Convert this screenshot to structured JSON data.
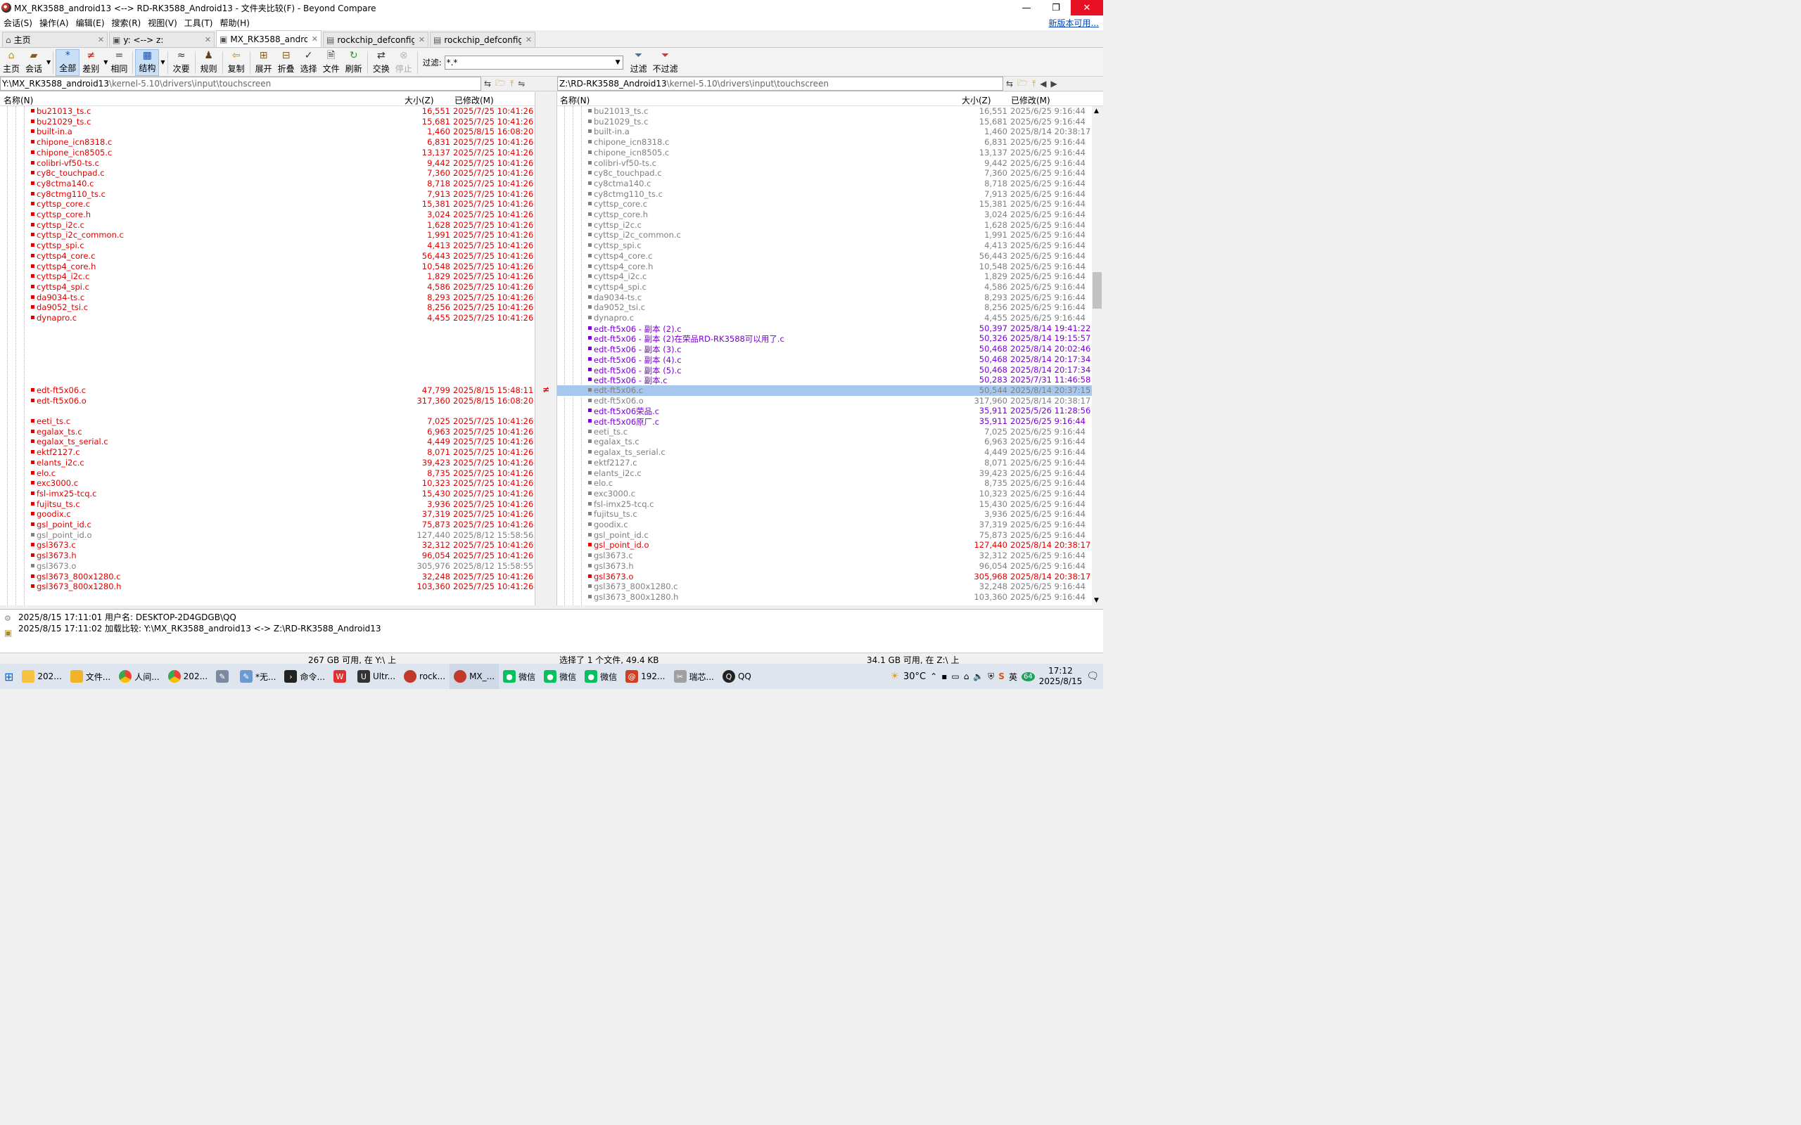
{
  "window": {
    "title": "MX_RK3588_android13 <--> RD-RK3588_Android13 - 文件夹比较(F) - Beyond Compare"
  },
  "menu": [
    "会话(S)",
    "操作(A)",
    "编辑(E)",
    "搜索(R)",
    "视图(V)",
    "工具(T)",
    "帮助(H)"
  ],
  "new_version": "新版本可用...",
  "tabs": [
    {
      "label": "主页"
    },
    {
      "label": "y: <--> z:"
    },
    {
      "label": "MX_RK3588_androi..."
    },
    {
      "label": "rockchip_defconfig"
    },
    {
      "label": "rockchip_defconfig ..."
    }
  ],
  "toolbar": {
    "home": "主页",
    "session": "会话",
    "all": "全部",
    "diff": "差别",
    "same": "相同",
    "structure": "结构",
    "minor": "次要",
    "rules": "规则",
    "copy": "复制",
    "expand": "展开",
    "collapse": "折叠",
    "select": "选择",
    "files": "文件",
    "refresh": "刷新",
    "swap": "交换",
    "stop": "停止",
    "filter_label": "过滤:",
    "filter_value": "*.*",
    "filter_btn": "过滤",
    "unfilter_btn": "不过滤"
  },
  "left": {
    "path_root": "Y:\\MX_RK3588_android13",
    "path_rest": "\\kernel-5.10\\drivers\\input\\touchscreen",
    "col_name": "名称(N)",
    "col_size": "大小(Z)",
    "col_modified": "已修改(M)",
    "rows": [
      {
        "name": "bu21013_ts.c",
        "size": "16,551",
        "date": "2025/7/25 10:41:26",
        "status": "red"
      },
      {
        "name": "bu21029_ts.c",
        "size": "15,681",
        "date": "2025/7/25 10:41:26",
        "status": "red"
      },
      {
        "name": "built-in.a",
        "size": "1,460",
        "date": "2025/8/15 16:08:20",
        "status": "red"
      },
      {
        "name": "chipone_icn8318.c",
        "size": "6,831",
        "date": "2025/7/25 10:41:26",
        "status": "red"
      },
      {
        "name": "chipone_icn8505.c",
        "size": "13,137",
        "date": "2025/7/25 10:41:26",
        "status": "red"
      },
      {
        "name": "colibri-vf50-ts.c",
        "size": "9,442",
        "date": "2025/7/25 10:41:26",
        "status": "red"
      },
      {
        "name": "cy8c_touchpad.c",
        "size": "7,360",
        "date": "2025/7/25 10:41:26",
        "status": "red"
      },
      {
        "name": "cy8ctma140.c",
        "size": "8,718",
        "date": "2025/7/25 10:41:26",
        "status": "red"
      },
      {
        "name": "cy8ctmg110_ts.c",
        "size": "7,913",
        "date": "2025/7/25 10:41:26",
        "status": "red"
      },
      {
        "name": "cyttsp_core.c",
        "size": "15,381",
        "date": "2025/7/25 10:41:26",
        "status": "red"
      },
      {
        "name": "cyttsp_core.h",
        "size": "3,024",
        "date": "2025/7/25 10:41:26",
        "status": "red"
      },
      {
        "name": "cyttsp_i2c.c",
        "size": "1,628",
        "date": "2025/7/25 10:41:26",
        "status": "red"
      },
      {
        "name": "cyttsp_i2c_common.c",
        "size": "1,991",
        "date": "2025/7/25 10:41:26",
        "status": "red"
      },
      {
        "name": "cyttsp_spi.c",
        "size": "4,413",
        "date": "2025/7/25 10:41:26",
        "status": "red"
      },
      {
        "name": "cyttsp4_core.c",
        "size": "56,443",
        "date": "2025/7/25 10:41:26",
        "status": "red"
      },
      {
        "name": "cyttsp4_core.h",
        "size": "10,548",
        "date": "2025/7/25 10:41:26",
        "status": "red"
      },
      {
        "name": "cyttsp4_i2c.c",
        "size": "1,829",
        "date": "2025/7/25 10:41:26",
        "status": "red"
      },
      {
        "name": "cyttsp4_spi.c",
        "size": "4,586",
        "date": "2025/7/25 10:41:26",
        "status": "red"
      },
      {
        "name": "da9034-ts.c",
        "size": "8,293",
        "date": "2025/7/25 10:41:26",
        "status": "red"
      },
      {
        "name": "da9052_tsi.c",
        "size": "8,256",
        "date": "2025/7/25 10:41:26",
        "status": "red"
      },
      {
        "name": "dynapro.c",
        "size": "4,455",
        "date": "2025/7/25 10:41:26",
        "status": "red"
      },
      {
        "name": "",
        "size": "",
        "date": "",
        "status": "empty"
      },
      {
        "name": "",
        "size": "",
        "date": "",
        "status": "empty"
      },
      {
        "name": "",
        "size": "",
        "date": "",
        "status": "empty"
      },
      {
        "name": "",
        "size": "",
        "date": "",
        "status": "empty"
      },
      {
        "name": "",
        "size": "",
        "date": "",
        "status": "empty"
      },
      {
        "name": "",
        "size": "",
        "date": "",
        "status": "empty"
      },
      {
        "name": "edt-ft5x06.c",
        "size": "47,799",
        "date": "2025/8/15 15:48:11",
        "status": "red"
      },
      {
        "name": "edt-ft5x06.o",
        "size": "317,360",
        "date": "2025/8/15 16:08:20",
        "status": "red"
      },
      {
        "name": "",
        "size": "",
        "date": "",
        "status": "empty"
      },
      {
        "name": "eeti_ts.c",
        "size": "7,025",
        "date": "2025/7/25 10:41:26",
        "status": "red"
      },
      {
        "name": "egalax_ts.c",
        "size": "6,963",
        "date": "2025/7/25 10:41:26",
        "status": "red"
      },
      {
        "name": "egalax_ts_serial.c",
        "size": "4,449",
        "date": "2025/7/25 10:41:26",
        "status": "red"
      },
      {
        "name": "ektf2127.c",
        "size": "8,071",
        "date": "2025/7/25 10:41:26",
        "status": "red"
      },
      {
        "name": "elants_i2c.c",
        "size": "39,423",
        "date": "2025/7/25 10:41:26",
        "status": "red"
      },
      {
        "name": "elo.c",
        "size": "8,735",
        "date": "2025/7/25 10:41:26",
        "status": "red"
      },
      {
        "name": "exc3000.c",
        "size": "10,323",
        "date": "2025/7/25 10:41:26",
        "status": "red"
      },
      {
        "name": "fsl-imx25-tcq.c",
        "size": "15,430",
        "date": "2025/7/25 10:41:26",
        "status": "red"
      },
      {
        "name": "fujitsu_ts.c",
        "size": "3,936",
        "date": "2025/7/25 10:41:26",
        "status": "red"
      },
      {
        "name": "goodix.c",
        "size": "37,319",
        "date": "2025/7/25 10:41:26",
        "status": "red"
      },
      {
        "name": "gsl_point_id.c",
        "size": "75,873",
        "date": "2025/7/25 10:41:26",
        "status": "red"
      },
      {
        "name": "gsl_point_id.o",
        "size": "127,440",
        "date": "2025/8/12 15:58:56",
        "status": "gray"
      },
      {
        "name": "gsl3673.c",
        "size": "32,312",
        "date": "2025/7/25 10:41:26",
        "status": "red"
      },
      {
        "name": "gsl3673.h",
        "size": "96,054",
        "date": "2025/7/25 10:41:26",
        "status": "red"
      },
      {
        "name": "gsl3673.o",
        "size": "305,976",
        "date": "2025/8/12 15:58:55",
        "status": "gray"
      },
      {
        "name": "gsl3673_800x1280.c",
        "size": "32,248",
        "date": "2025/7/25 10:41:26",
        "status": "red"
      },
      {
        "name": "gsl3673_800x1280.h",
        "size": "103,360",
        "date": "2025/7/25 10:41:26",
        "status": "red"
      }
    ]
  },
  "right": {
    "path_root": "Z:\\RD-RK3588_Android13",
    "path_rest": "\\kernel-5.10\\drivers\\input\\touchscreen",
    "col_name": "名称(N)",
    "col_size": "大小(Z)",
    "col_modified": "已修改(M)",
    "rows": [
      {
        "name": "bu21013_ts.c",
        "size": "16,551",
        "date": "2025/6/25 9:16:44",
        "status": "gray"
      },
      {
        "name": "bu21029_ts.c",
        "size": "15,681",
        "date": "2025/6/25 9:16:44",
        "status": "gray"
      },
      {
        "name": "built-in.a",
        "size": "1,460",
        "date": "2025/8/14 20:38:17",
        "status": "gray"
      },
      {
        "name": "chipone_icn8318.c",
        "size": "6,831",
        "date": "2025/6/25 9:16:44",
        "status": "gray"
      },
      {
        "name": "chipone_icn8505.c",
        "size": "13,137",
        "date": "2025/6/25 9:16:44",
        "status": "gray"
      },
      {
        "name": "colibri-vf50-ts.c",
        "size": "9,442",
        "date": "2025/6/25 9:16:44",
        "status": "gray"
      },
      {
        "name": "cy8c_touchpad.c",
        "size": "7,360",
        "date": "2025/6/25 9:16:44",
        "status": "gray"
      },
      {
        "name": "cy8ctma140.c",
        "size": "8,718",
        "date": "2025/6/25 9:16:44",
        "status": "gray"
      },
      {
        "name": "cy8ctmg110_ts.c",
        "size": "7,913",
        "date": "2025/6/25 9:16:44",
        "status": "gray"
      },
      {
        "name": "cyttsp_core.c",
        "size": "15,381",
        "date": "2025/6/25 9:16:44",
        "status": "gray"
      },
      {
        "name": "cyttsp_core.h",
        "size": "3,024",
        "date": "2025/6/25 9:16:44",
        "status": "gray"
      },
      {
        "name": "cyttsp_i2c.c",
        "size": "1,628",
        "date": "2025/6/25 9:16:44",
        "status": "gray"
      },
      {
        "name": "cyttsp_i2c_common.c",
        "size": "1,991",
        "date": "2025/6/25 9:16:44",
        "status": "gray"
      },
      {
        "name": "cyttsp_spi.c",
        "size": "4,413",
        "date": "2025/6/25 9:16:44",
        "status": "gray"
      },
      {
        "name": "cyttsp4_core.c",
        "size": "56,443",
        "date": "2025/6/25 9:16:44",
        "status": "gray"
      },
      {
        "name": "cyttsp4_core.h",
        "size": "10,548",
        "date": "2025/6/25 9:16:44",
        "status": "gray"
      },
      {
        "name": "cyttsp4_i2c.c",
        "size": "1,829",
        "date": "2025/6/25 9:16:44",
        "status": "gray"
      },
      {
        "name": "cyttsp4_spi.c",
        "size": "4,586",
        "date": "2025/6/25 9:16:44",
        "status": "gray"
      },
      {
        "name": "da9034-ts.c",
        "size": "8,293",
        "date": "2025/6/25 9:16:44",
        "status": "gray"
      },
      {
        "name": "da9052_tsi.c",
        "size": "8,256",
        "date": "2025/6/25 9:16:44",
        "status": "gray"
      },
      {
        "name": "dynapro.c",
        "size": "4,455",
        "date": "2025/6/25 9:16:44",
        "status": "gray"
      },
      {
        "name": "edt-ft5x06 - 副本 (2).c",
        "size": "50,397",
        "date": "2025/8/14 19:41:22",
        "status": "purple"
      },
      {
        "name": "edt-ft5x06 - 副本 (2)在荣品RD-RK3588可以用了.c",
        "size": "50,326",
        "date": "2025/8/14 19:15:57",
        "status": "purple"
      },
      {
        "name": "edt-ft5x06 - 副本 (3).c",
        "size": "50,468",
        "date": "2025/8/14 20:02:46",
        "status": "purple"
      },
      {
        "name": "edt-ft5x06 - 副本 (4).c",
        "size": "50,468",
        "date": "2025/8/14 20:17:34",
        "status": "purple"
      },
      {
        "name": "edt-ft5x06 - 副本 (5).c",
        "size": "50,468",
        "date": "2025/8/14 20:17:34",
        "status": "purple"
      },
      {
        "name": "edt-ft5x06 - 副本.c",
        "size": "50,283",
        "date": "2025/7/31 11:46:58",
        "status": "purple"
      },
      {
        "name": "edt-ft5x06.c",
        "size": "50,544",
        "date": "2025/8/14 20:37:15",
        "status": "sel"
      },
      {
        "name": "edt-ft5x06.o",
        "size": "317,960",
        "date": "2025/8/14 20:38:17",
        "status": "gray"
      },
      {
        "name": "edt-ft5x06荣品.c",
        "size": "35,911",
        "date": "2025/5/26 11:28:56",
        "status": "purple"
      },
      {
        "name": "edt-ft5x06原厂.c",
        "size": "35,911",
        "date": "2025/6/25 9:16:44",
        "status": "purple"
      },
      {
        "name": "eeti_ts.c",
        "size": "7,025",
        "date": "2025/6/25 9:16:44",
        "status": "gray"
      },
      {
        "name": "egalax_ts.c",
        "size": "6,963",
        "date": "2025/6/25 9:16:44",
        "status": "gray"
      },
      {
        "name": "egalax_ts_serial.c",
        "size": "4,449",
        "date": "2025/6/25 9:16:44",
        "status": "gray"
      },
      {
        "name": "ektf2127.c",
        "size": "8,071",
        "date": "2025/6/25 9:16:44",
        "status": "gray"
      },
      {
        "name": "elants_i2c.c",
        "size": "39,423",
        "date": "2025/6/25 9:16:44",
        "status": "gray"
      },
      {
        "name": "elo.c",
        "size": "8,735",
        "date": "2025/6/25 9:16:44",
        "status": "gray"
      },
      {
        "name": "exc3000.c",
        "size": "10,323",
        "date": "2025/6/25 9:16:44",
        "status": "gray"
      },
      {
        "name": "fsl-imx25-tcq.c",
        "size": "15,430",
        "date": "2025/6/25 9:16:44",
        "status": "gray"
      },
      {
        "name": "fujitsu_ts.c",
        "size": "3,936",
        "date": "2025/6/25 9:16:44",
        "status": "gray"
      },
      {
        "name": "goodix.c",
        "size": "37,319",
        "date": "2025/6/25 9:16:44",
        "status": "gray"
      },
      {
        "name": "gsl_point_id.c",
        "size": "75,873",
        "date": "2025/6/25 9:16:44",
        "status": "gray"
      },
      {
        "name": "gsl_point_id.o",
        "size": "127,440",
        "date": "2025/8/14 20:38:17",
        "status": "red"
      },
      {
        "name": "gsl3673.c",
        "size": "32,312",
        "date": "2025/6/25 9:16:44",
        "status": "gray"
      },
      {
        "name": "gsl3673.h",
        "size": "96,054",
        "date": "2025/6/25 9:16:44",
        "status": "gray"
      },
      {
        "name": "gsl3673.o",
        "size": "305,968",
        "date": "2025/8/14 20:38:17",
        "status": "red"
      },
      {
        "name": "gsl3673_800x1280.c",
        "size": "32,248",
        "date": "2025/6/25 9:16:44",
        "status": "gray"
      },
      {
        "name": "gsl3673_800x1280.h",
        "size": "103,360",
        "date": "2025/6/25 9:16:44",
        "status": "gray"
      }
    ]
  },
  "gutter_diff_mark": "≠",
  "log": [
    "2025/8/15 17:11:01  用户名: DESKTOP-2D4GDGB\\QQ",
    "2025/8/15 17:11:02  加载比较: Y:\\MX_RK3588_android13 <-> Z:\\RD-RK3588_Android13"
  ],
  "status": {
    "left_free": "267 GB 可用, 在 Y:\\ 上",
    "selection": "选择了 1 个文件, 49.4 KB",
    "right_free": "34.1 GB 可用, 在 Z:\\ 上"
  },
  "taskbar": {
    "items": [
      "202...",
      "文件...",
      "人间...",
      "202...",
      "",
      "*无...",
      "命令...",
      "",
      "Ultr...",
      "rock...",
      "MX_...",
      "微信",
      "微信",
      "微信",
      "192...",
      "瑞芯...",
      "QQ"
    ],
    "weather": "30°C",
    "time": "17:12",
    "date": "2025/8/15",
    "ime": "英",
    "tray_badge": "64"
  },
  "colors": {
    "diff_red": "#e00000",
    "orphan_purple": "#7a00d6",
    "same_gray": "#808080",
    "selection": "#a7c8ec"
  }
}
